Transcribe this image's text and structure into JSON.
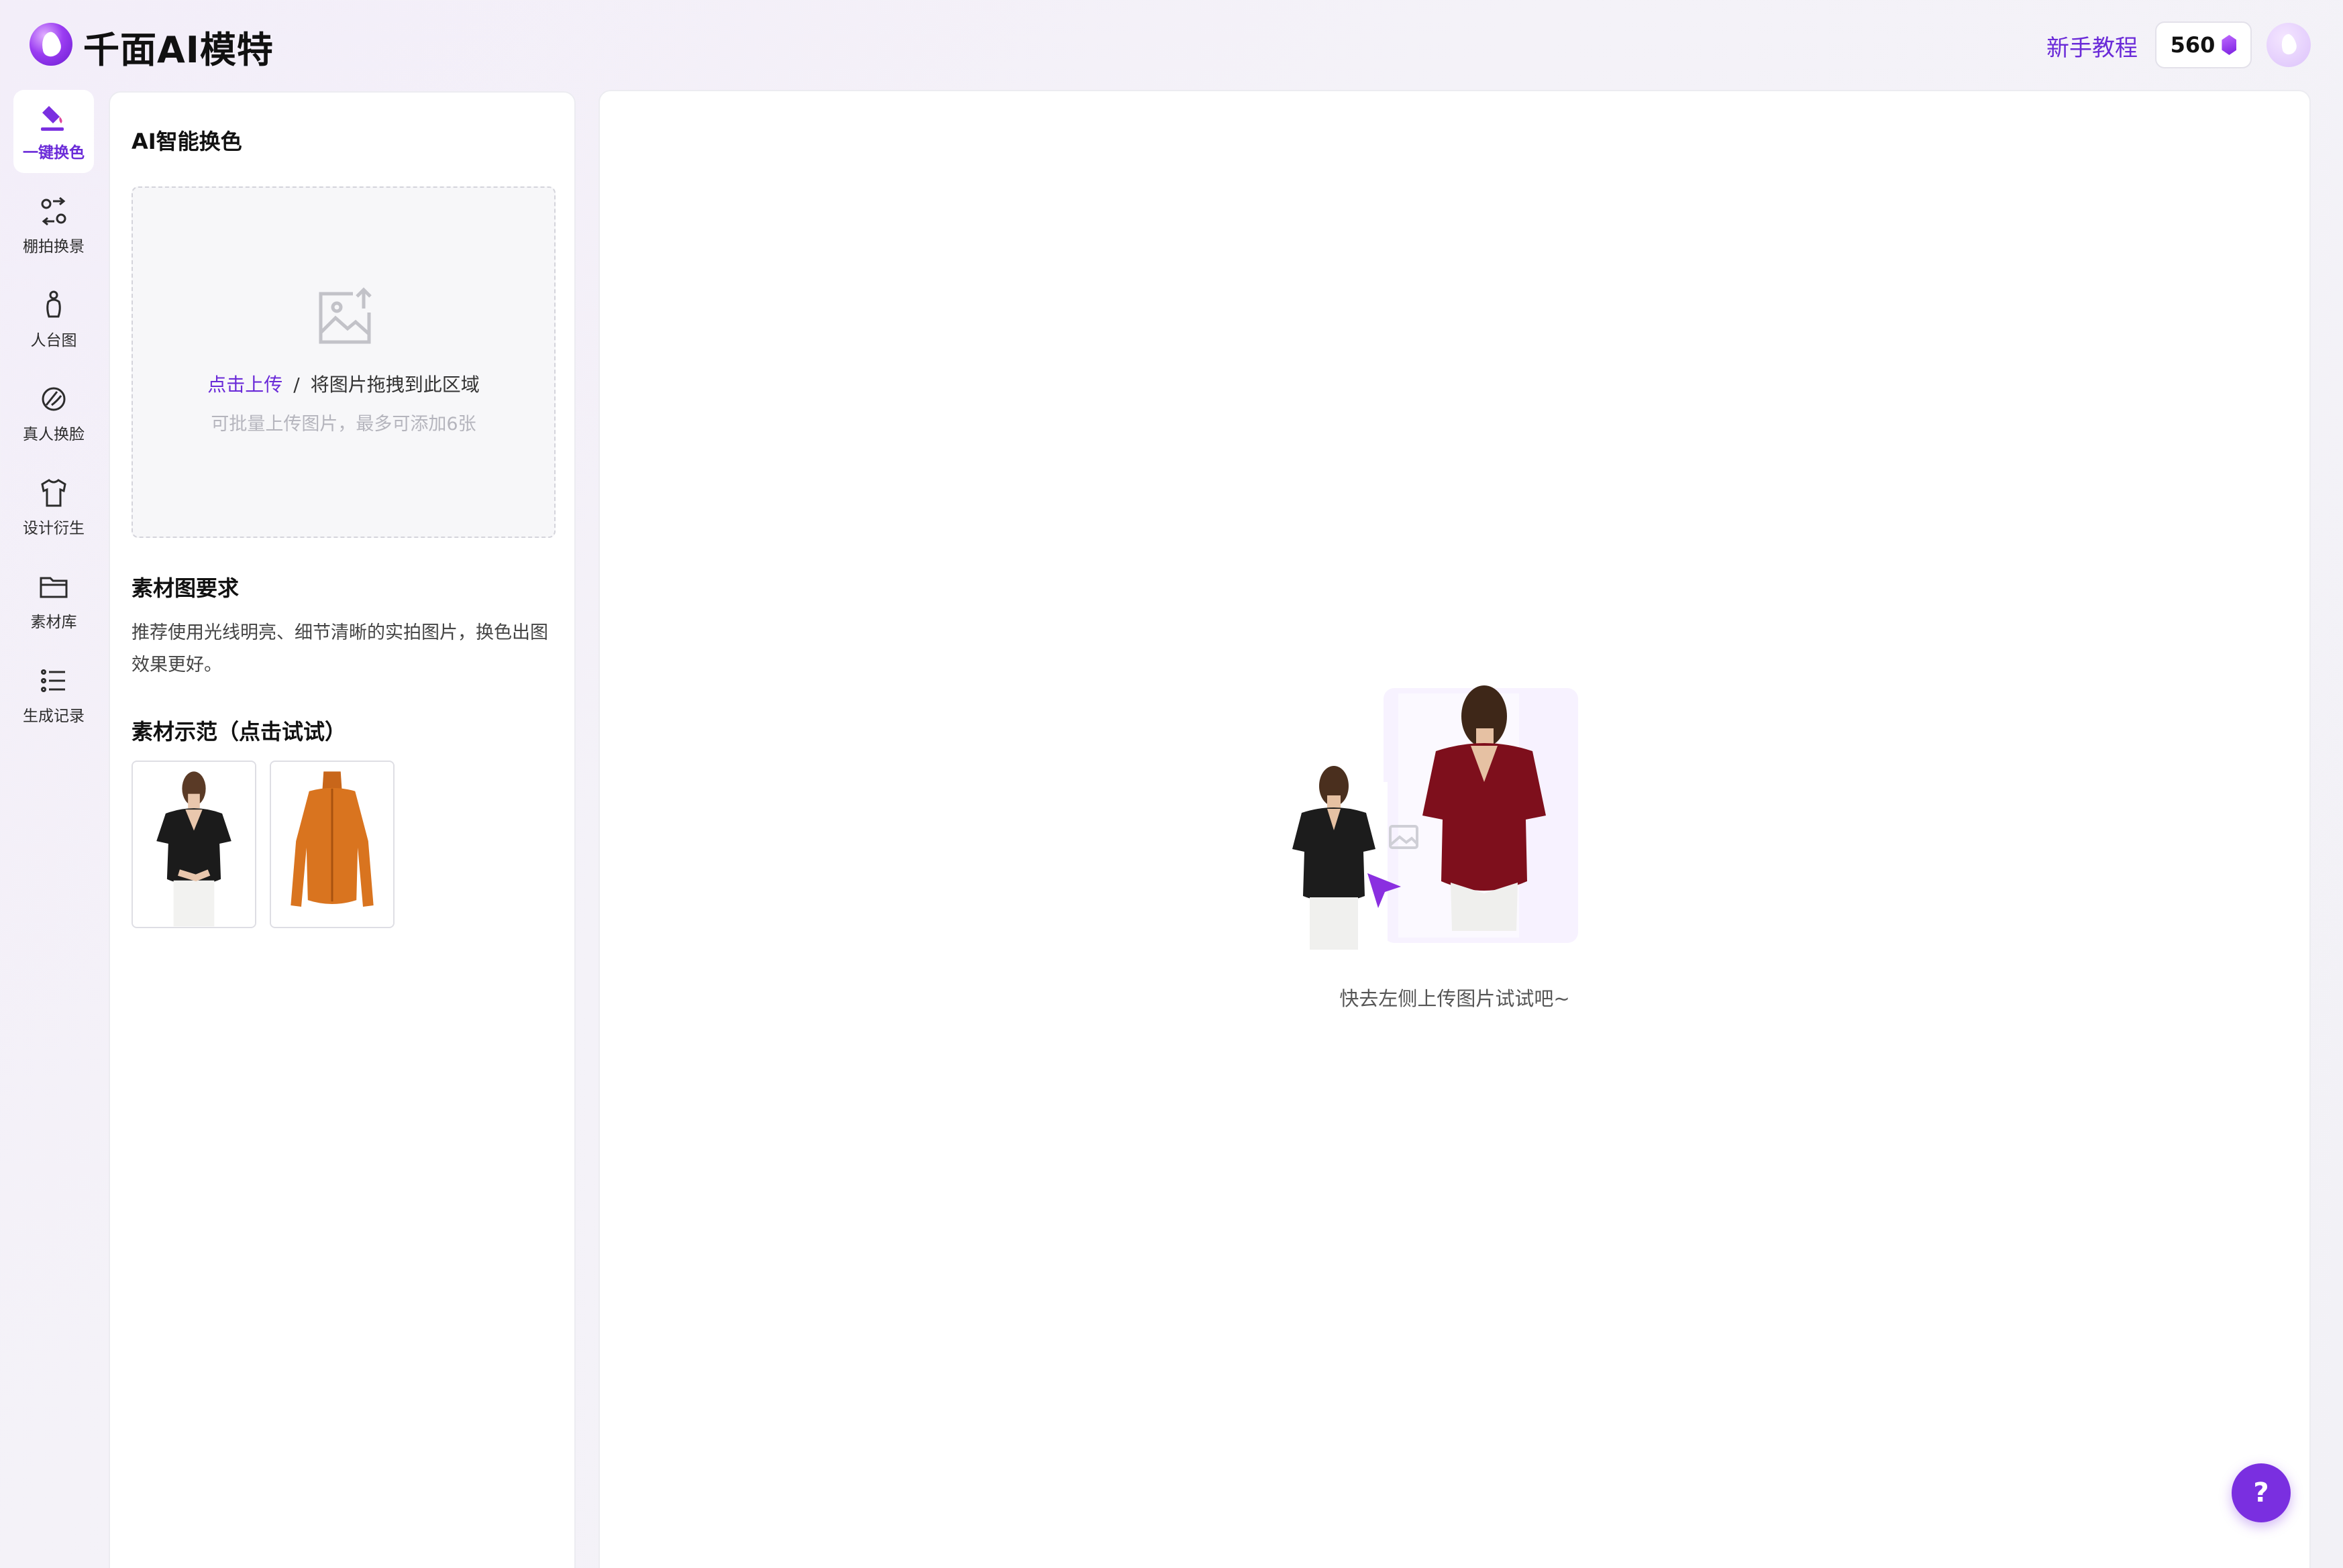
{
  "app": {
    "name": "千面AI模特",
    "tutorial_link": "新手教程",
    "credits": "560",
    "brand_color": "#6a2ad8"
  },
  "sidebar": {
    "items": [
      {
        "label": "一键换色",
        "icon": "paint-bucket-icon",
        "active": true
      },
      {
        "label": "棚拍换景",
        "icon": "scene-swap-icon",
        "active": false
      },
      {
        "label": "人台图",
        "icon": "mannequin-icon",
        "active": false
      },
      {
        "label": "真人换脸",
        "icon": "face-swap-icon",
        "active": false
      },
      {
        "label": "设计衍生",
        "icon": "shirt-icon",
        "active": false
      },
      {
        "label": "素材库",
        "icon": "folder-icon",
        "active": false
      },
      {
        "label": "生成记录",
        "icon": "list-icon",
        "active": false
      }
    ]
  },
  "panel": {
    "title": "AI智能换色",
    "upload": {
      "link_text": "点击上传",
      "separator": "/",
      "drag_text": "将图片拖拽到此区域",
      "hint": "可批量上传图片，最多可添加6张"
    },
    "requirements": {
      "title": "素材图要求",
      "text": "推荐使用光线明亮、细节清晰的实拍图片，换色出图效果更好。"
    },
    "demo": {
      "title": "素材示范（点击试试）",
      "thumbs": [
        {
          "name": "black-blouse",
          "color": "#1b1b1b"
        },
        {
          "name": "orange-jacket",
          "color": "#d9741f"
        }
      ]
    }
  },
  "main": {
    "empty_hint": "快去左侧上传图片试试吧~",
    "help_button": "?"
  }
}
